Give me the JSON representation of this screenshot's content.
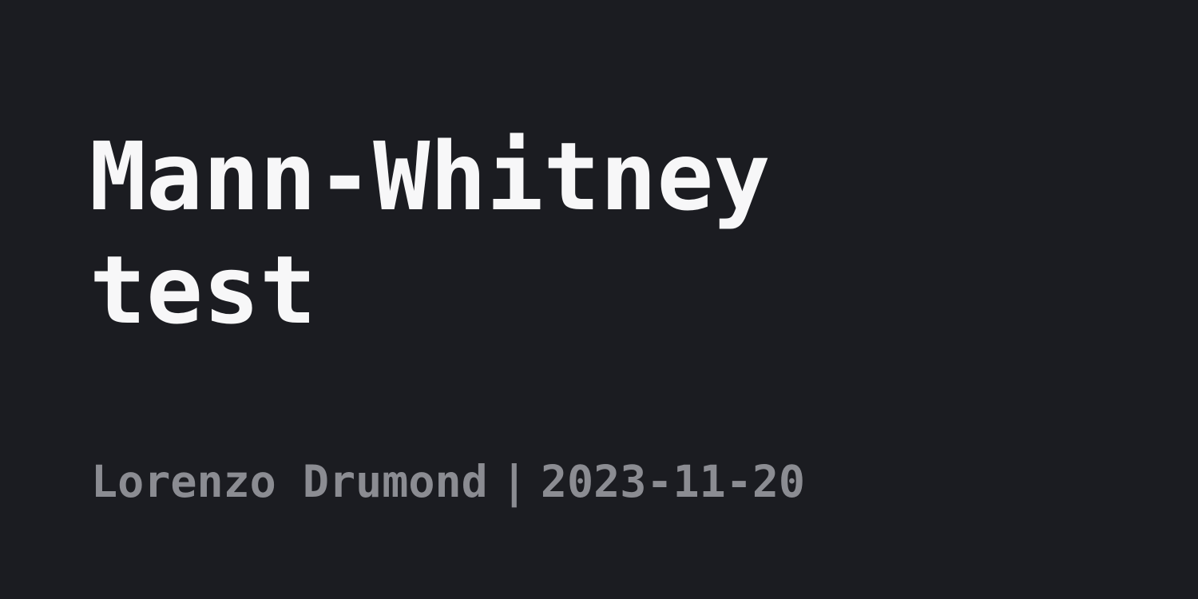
{
  "title": "Mann-Whitney test",
  "meta": {
    "author": "Lorenzo Drumond",
    "separator": "|",
    "date": "2023-11-20"
  },
  "colors": {
    "background": "#1b1c21",
    "title": "#f7f7f8",
    "meta": "#8b8c92"
  }
}
